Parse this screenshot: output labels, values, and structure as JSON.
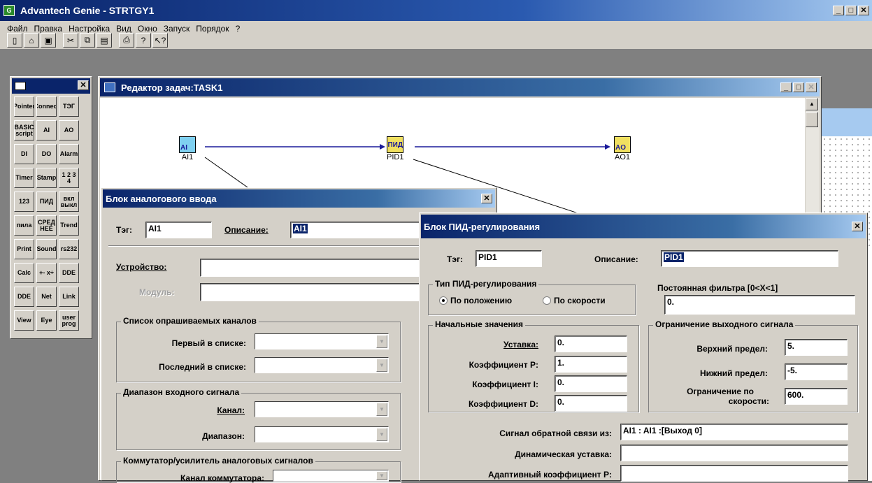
{
  "app": {
    "title": "Advantech Genie - STRTGY1",
    "icon": "genie-app-icon"
  },
  "menu": [
    "Файл",
    "Правка",
    "Настройка",
    "Вид",
    "Окно",
    "Запуск",
    "Порядок",
    "?"
  ],
  "toolbar": [
    "new-icon",
    "open-icon",
    "save-icon",
    "cut-icon",
    "copy-icon",
    "paste-icon",
    "print-icon",
    "help-icon",
    "context-help-icon"
  ],
  "palette": [
    [
      "Pointer",
      "Connect",
      "ТЭГ"
    ],
    [
      "BASIC script",
      "AI",
      "AO"
    ],
    [
      "DI",
      "DO",
      "Alarm"
    ],
    [
      "Timer",
      "Stamp",
      "1 2 3 4"
    ],
    [
      "123",
      "ПИД",
      "вкл выкл"
    ],
    [
      "пила",
      "СРЕД НЕЕ",
      "Trend"
    ],
    [
      "Print",
      "Sound",
      "rs232"
    ],
    [
      "Calc",
      "+- x÷",
      "DDE"
    ],
    [
      "DDE",
      "Net",
      "Link"
    ],
    [
      "View",
      "Eye",
      "user prog"
    ]
  ],
  "task_editor": {
    "title": "Редактор задач:TASK1",
    "nodes": [
      {
        "label": "AI1",
        "icon": "AI"
      },
      {
        "label": "PID1",
        "icon": "ПИД"
      },
      {
        "label": "AO1",
        "icon": "AO"
      }
    ]
  },
  "ai_dialog": {
    "title": "Блок аналогового ввода",
    "tag_label": "Тэг:",
    "tag_value": "AI1",
    "desc_label": "Описание:",
    "desc_value": "AI1",
    "device_label": "Устройство:",
    "module_label": "Модуль:",
    "group_channels": "Список опрашиваемых каналов",
    "first_label": "Первый в списке:",
    "last_label": "Последний в списке:",
    "group_range": "Диапазон входного сигнала",
    "channel_label": "Канал:",
    "range_label": "Диапазон:",
    "group_mux": "Коммутатор/усилитель аналоговых сигналов",
    "mux_channel_label": "Канал коммутатора:"
  },
  "pid_dialog": {
    "title": "Блок ПИД-регулирования",
    "tag_label": "Тэг:",
    "tag_value": "PID1",
    "desc_label": "Описание:",
    "desc_value": "PID1",
    "group_type": "Тип ПИД-регулирования",
    "radio_position": "По положению",
    "radio_speed": "По скорости",
    "filter_label": "Постоянная фильтра [0<X<1]",
    "filter_value": "0.",
    "group_initial": "Начальные значения",
    "setpoint_label": "Уставка:",
    "setpoint_value": "0.",
    "kp_label": "Коэффициент P:",
    "kp_value": "1.",
    "ki_label": "Коэффициент I:",
    "ki_value": "0.",
    "kd_label": "Коэффициент D:",
    "kd_value": "0.",
    "group_limit": "Ограничение выходного сигнала",
    "upper_label": "Верхний предел:",
    "upper_value": "5.",
    "lower_label": "Нижний предел:",
    "lower_value": "-5.",
    "rate_label1": "Ограничение по",
    "rate_label2": "скорости:",
    "rate_value": "600.",
    "feedback_label": "Сигнал обратной связи из:",
    "feedback_value": "AI1 : AI1 :[Выход 0]",
    "dyn_setpoint_label": "Динамическая уставка:",
    "dyn_setpoint_value": "",
    "adaptive_label": "Адаптивный коэффициент P:",
    "adaptive_value": ""
  }
}
